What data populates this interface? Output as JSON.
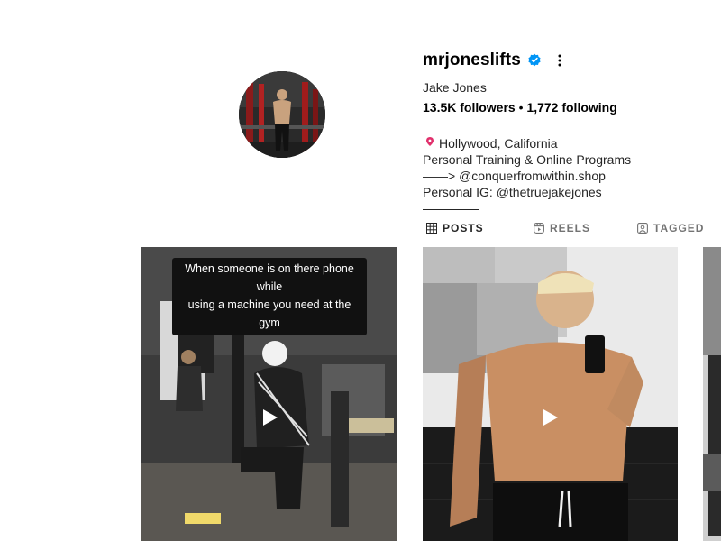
{
  "profile": {
    "username": "mrjoneslifts",
    "full_name": "Jake Jones",
    "followers_count": "13.5K",
    "followers_label": "followers",
    "separator": "•",
    "following_count": "1,772",
    "following_label": "following",
    "bio": {
      "location": "Hollywood, California",
      "line2": "Personal Training & Online Programs",
      "line3": "——> @conquerfromwithin.shop",
      "line4": "Personal IG: @thetruejakejones"
    }
  },
  "tabs": [
    {
      "label": "POSTS",
      "icon": "grid-icon",
      "active": true
    },
    {
      "label": "REELS",
      "icon": "reels-icon",
      "active": false
    },
    {
      "label": "TAGGED",
      "icon": "tagged-icon",
      "active": false
    }
  ],
  "posts": [
    {
      "type": "reel",
      "caption_line1": "When someone is on there phone while",
      "caption_line2": "using a machine you need at the gym"
    },
    {
      "type": "reel",
      "caption_line1": "",
      "caption_line2": ""
    },
    {
      "type": "reel",
      "caption_line1": "",
      "caption_line2": ""
    }
  ],
  "colors": {
    "verified_badge": "#0095f6",
    "location_pin": "#e1306c",
    "text_primary": "#262626",
    "text_secondary": "#737373"
  }
}
